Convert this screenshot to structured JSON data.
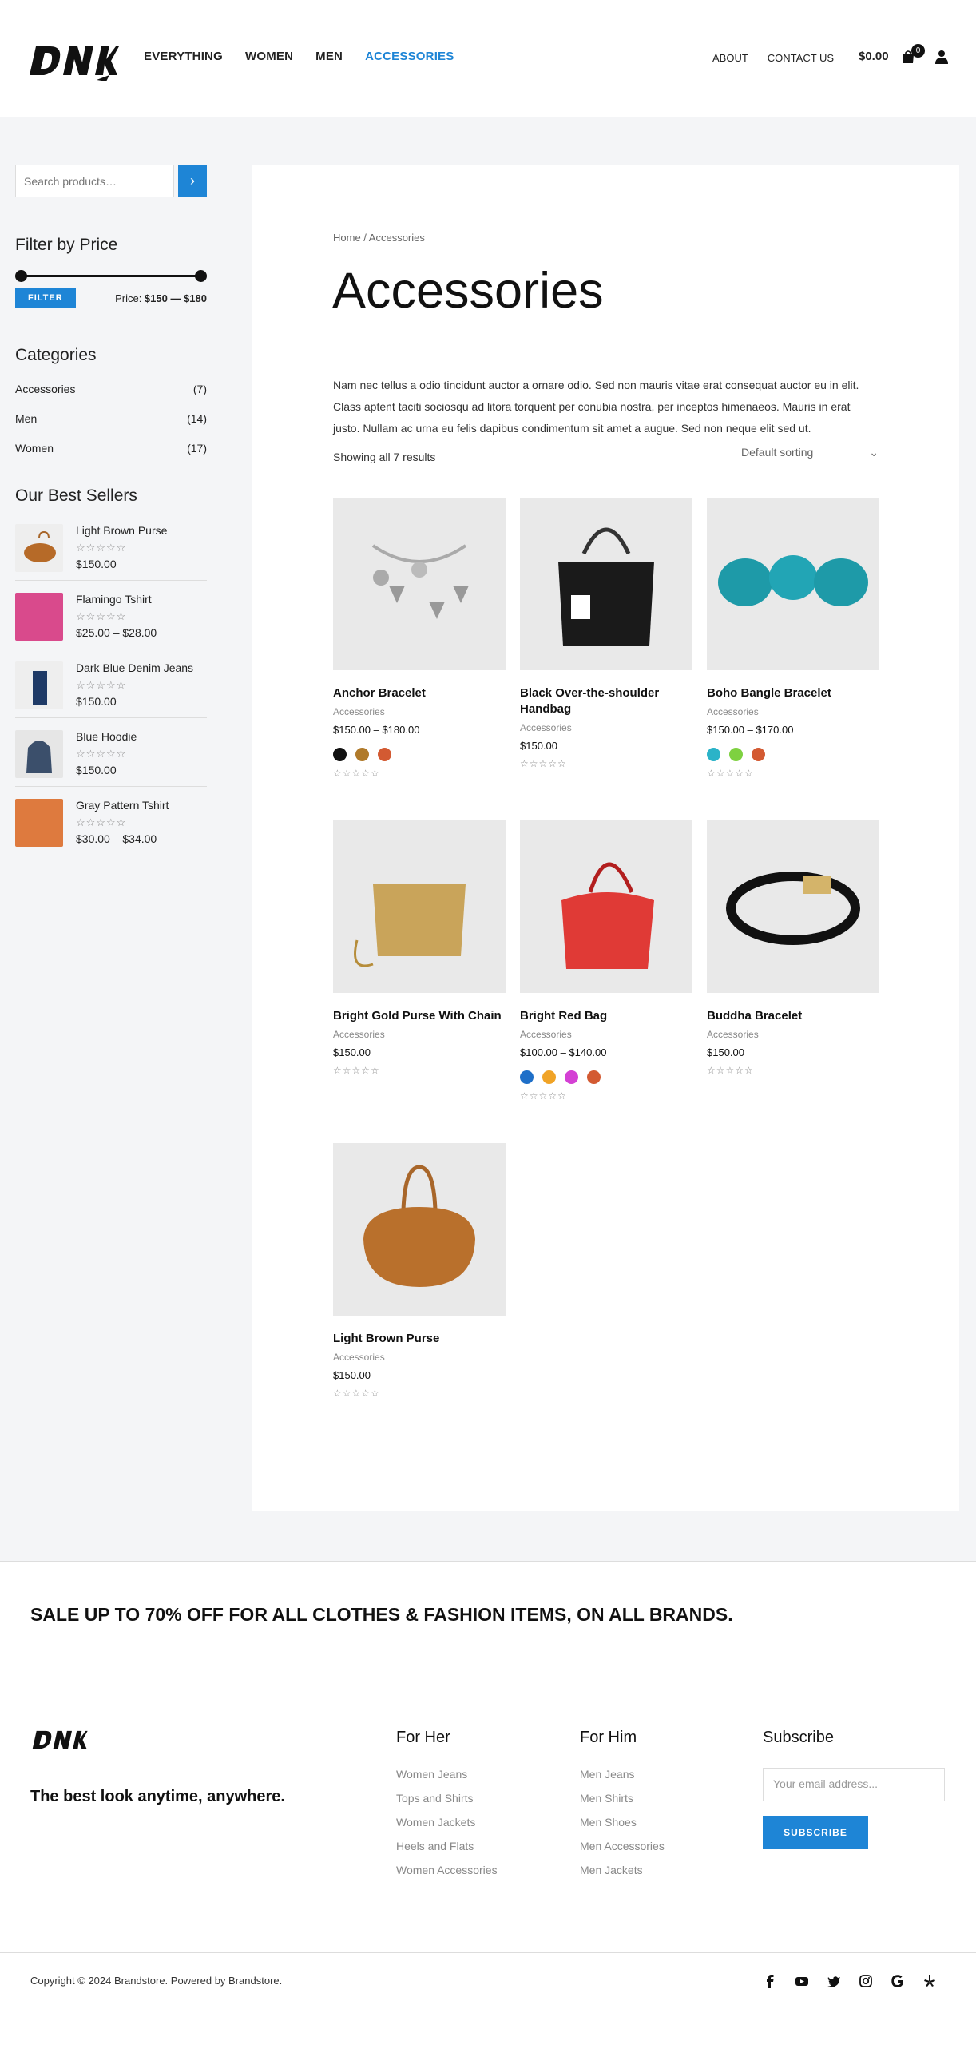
{
  "header": {
    "logo_text": "DNK",
    "nav": [
      "EVERYTHING",
      "WOMEN",
      "MEN",
      "ACCESSORIES"
    ],
    "nav_active": "ACCESSORIES",
    "secondary_nav": [
      "ABOUT",
      "CONTACT US"
    ],
    "cart_total": "$0.00",
    "cart_count": "0"
  },
  "sidebar": {
    "search_placeholder": "Search products…",
    "filter_title": "Filter by Price",
    "filter_button": "FILTER",
    "price_prefix": "Price: ",
    "price_range": "$150 — $180",
    "categories_title": "Categories",
    "categories": [
      {
        "name": "Accessories",
        "count": "(7)"
      },
      {
        "name": "Men",
        "count": "(14)"
      },
      {
        "name": "Women",
        "count": "(17)"
      }
    ],
    "bestsellers_title": "Our Best Sellers",
    "bestsellers": [
      {
        "name": "Light Brown Purse",
        "price": "$150.00"
      },
      {
        "name": "Flamingo Tshirt",
        "price": "$25.00 – $28.00"
      },
      {
        "name": "Dark Blue Denim Jeans",
        "price": "$150.00"
      },
      {
        "name": "Blue Hoodie",
        "price": "$150.00"
      },
      {
        "name": "Gray Pattern Tshirt",
        "price": "$30.00 – $34.00"
      }
    ]
  },
  "main": {
    "breadcrumb": "Home / Accessories",
    "title": "Accessories",
    "description": "Nam nec tellus a odio tincidunt auctor a ornare odio. Sed non mauris vitae erat consequat auctor eu in elit. Class aptent taciti sociosqu ad litora torquent per conubia nostra, per inceptos himenaeos. Mauris in erat justo. Nullam ac urna eu felis dapibus condimentum sit amet a augue. Sed non neque elit sed ut.",
    "showing": "Showing all 7 results",
    "sorting": "Default sorting",
    "products": [
      {
        "name": "Anchor Bracelet",
        "category": "Accessories",
        "price": "$150.00 – $180.00",
        "swatches": [
          "#111111",
          "#b07a2a",
          "#d35a32"
        ]
      },
      {
        "name": "Black Over-the-shoulder Handbag",
        "category": "Accessories",
        "price": "$150.00",
        "swatches": []
      },
      {
        "name": "Boho Bangle Bracelet",
        "category": "Accessories",
        "price": "$150.00 – $170.00",
        "swatches": [
          "#2bb3c8",
          "#7ed140",
          "#d35a32"
        ]
      },
      {
        "name": "Bright Gold Purse With Chain",
        "category": "Accessories",
        "price": "$150.00",
        "swatches": []
      },
      {
        "name": "Bright Red Bag",
        "category": "Accessories",
        "price": "$100.00 – $140.00",
        "swatches": [
          "#1e6fc8",
          "#f0a326",
          "#d440d4",
          "#d35a32"
        ]
      },
      {
        "name": "Buddha Bracelet",
        "category": "Accessories",
        "price": "$150.00",
        "swatches": []
      },
      {
        "name": "Light Brown Purse",
        "category": "Accessories",
        "price": "$150.00",
        "swatches": []
      }
    ]
  },
  "promo": {
    "text": "SALE UP TO 70% OFF FOR ALL CLOTHES & FASHION ITEMS, ON ALL BRANDS."
  },
  "footer": {
    "tagline": "The best look anytime, anywhere.",
    "her_title": "For Her",
    "her_links": [
      "Women Jeans",
      "Tops and Shirts",
      "Women Jackets",
      "Heels and Flats",
      "Women Accessories"
    ],
    "him_title": "For Him",
    "him_links": [
      "Men Jeans",
      "Men Shirts",
      "Men Shoes",
      "Men Accessories",
      "Men Jackets"
    ],
    "subscribe_title": "Subscribe",
    "email_placeholder": "Your email address...",
    "subscribe_button": "SUBSCRIBE",
    "copyright": "Copyright © 2024 Brandstore. Powered by Brandstore.",
    "social_icons": [
      "facebook-icon",
      "youtube-icon",
      "twitter-icon",
      "instagram-icon",
      "google-icon",
      "yelp-icon"
    ]
  },
  "colors": {
    "accent": "#1e85d6",
    "page_bg": "#f4f5f7"
  }
}
